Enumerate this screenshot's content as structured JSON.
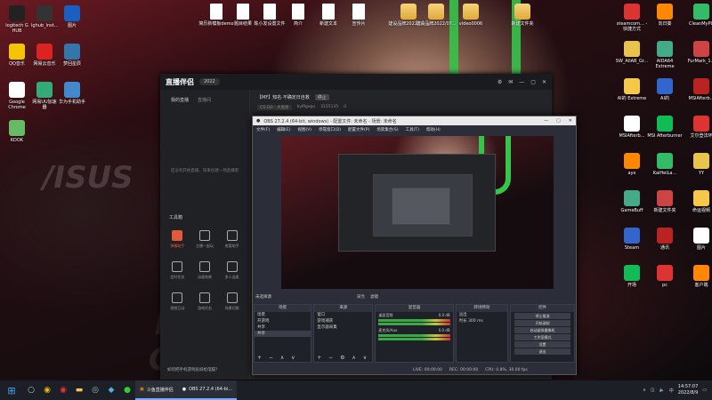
{
  "desktop": {
    "left_icons": [
      {
        "label": "logitech G HUB",
        "x": 0,
        "y": 0
      },
      {
        "label": "lghub_inst...",
        "x": 1,
        "y": 0
      },
      {
        "label": "图片",
        "x": 2,
        "y": 0
      },
      {
        "label": "QQ音乐",
        "x": 0,
        "y": 1
      },
      {
        "label": "网易云音乐",
        "x": 1,
        "y": 1
      },
      {
        "label": "梦回星辰",
        "x": 2,
        "y": 1
      },
      {
        "label": "Google Chrome",
        "x": 0,
        "y": 2
      },
      {
        "label": "网易UU加速器",
        "x": 1,
        "y": 2
      },
      {
        "label": "华为手机助手",
        "x": 2,
        "y": 2
      },
      {
        "label": "KOOK",
        "x": 0,
        "y": 3
      }
    ],
    "top_icons": [
      "简历新模板demo",
      "题目结果",
      "陈小发设置文件",
      "简介",
      "新建文本",
      "宣传片",
      "建设品牌2022/07...",
      "建设品牌2022/07...",
      "video0006",
      "新建文件夹"
    ],
    "right_icons": [
      {
        "label": "steamcom... - 快捷方式"
      },
      {
        "label": "向日葵"
      },
      {
        "label": "CleanMyPC"
      },
      {
        "label": "SW_AllAB_Gr..."
      },
      {
        "label": "AIDA64 Extreme"
      },
      {
        "label": "FurMark_1..."
      },
      {
        "label": "AI的 Extreme"
      },
      {
        "label": "AI的"
      },
      {
        "label": "MSIAfterb..."
      },
      {
        "label": "MSIAfterb..."
      },
      {
        "label": "MSI Afterburner"
      },
      {
        "label": "艾尔登法环"
      },
      {
        "label": "ayx"
      },
      {
        "label": "KaiHeiLa..."
      },
      {
        "label": "YY"
      },
      {
        "label": "GameBuff"
      },
      {
        "label": "新建文件夹"
      },
      {
        "label": "命运视频"
      },
      {
        "label": "Steam"
      },
      {
        "label": "通讯"
      },
      {
        "label": "图片"
      },
      {
        "label": "开场"
      },
      {
        "label": "pc"
      },
      {
        "label": "客户端"
      }
    ]
  },
  "app": {
    "logo": "直播伴侣",
    "version": "2022",
    "tabs": [
      "我的直播",
      "直播间"
    ],
    "empty_text": "还没有开始直播，快来创建一场直播吧",
    "tools_title": "工具箱",
    "tools": [
      "弹幕助手",
      "主播一起玩",
      "房管助手",
      "定时任务",
      "动画效果",
      "多人连麦",
      "视频互动",
      "游戏任务",
      "场景切换"
    ],
    "help": "如何把手机游戏投屏给电脑？",
    "room_title": "【MF】知名·不确定日自救",
    "room_tag": "停止",
    "category": "CS:GO - 大逃杀",
    "streamer": "byMgogo",
    "room_id": "3155135",
    "likes": "0"
  },
  "obs": {
    "title": "OBS 27.2.4 (64-bit, windows) - 配置文件: 未命名 - 场景: 未命名",
    "menu": [
      "文件(F)",
      "编辑(E)",
      "视图(V)",
      "停靠窗口(D)",
      "配置文件(P)",
      "场景集合(S)",
      "工具(T)",
      "帮助(H)"
    ],
    "source_header": "未选择源",
    "props": "属性",
    "filters": "滤镜",
    "docks": {
      "scenes": {
        "title": "场景",
        "items": [
          "场景",
          "开游戏",
          "共享",
          "共享"
        ]
      },
      "sources": {
        "title": "来源",
        "items": [
          "窗口",
          "游戏捕获",
          "显示器采集"
        ]
      },
      "mixer": {
        "title": "混音器",
        "channels": [
          {
            "name": "桌面音频",
            "db": "0.0 dB"
          },
          {
            "name": "麦克风/Aux",
            "db": "0.0 dB"
          }
        ]
      },
      "transitions": {
        "title": "转场特效",
        "type": "淡出",
        "duration_label": "时长",
        "duration": "300 ms"
      },
      "controls": {
        "title": "控件",
        "buttons": [
          "停止推流",
          "开始录制",
          "启动虚拟摄像机",
          "工作室模式",
          "设置",
          "退出"
        ]
      }
    },
    "status": {
      "live": "LIVE: 00:00:00",
      "rec": "REC: 00:00:00",
      "cpu": "CPU: 0.8%, 30.00 fps"
    }
  },
  "taskbar": {
    "tasks": [
      "斗鱼直播伴侣",
      "OBS 27.2.4 (64-bi..."
    ],
    "time": "14:57:07",
    "date": "2022/8/9"
  }
}
